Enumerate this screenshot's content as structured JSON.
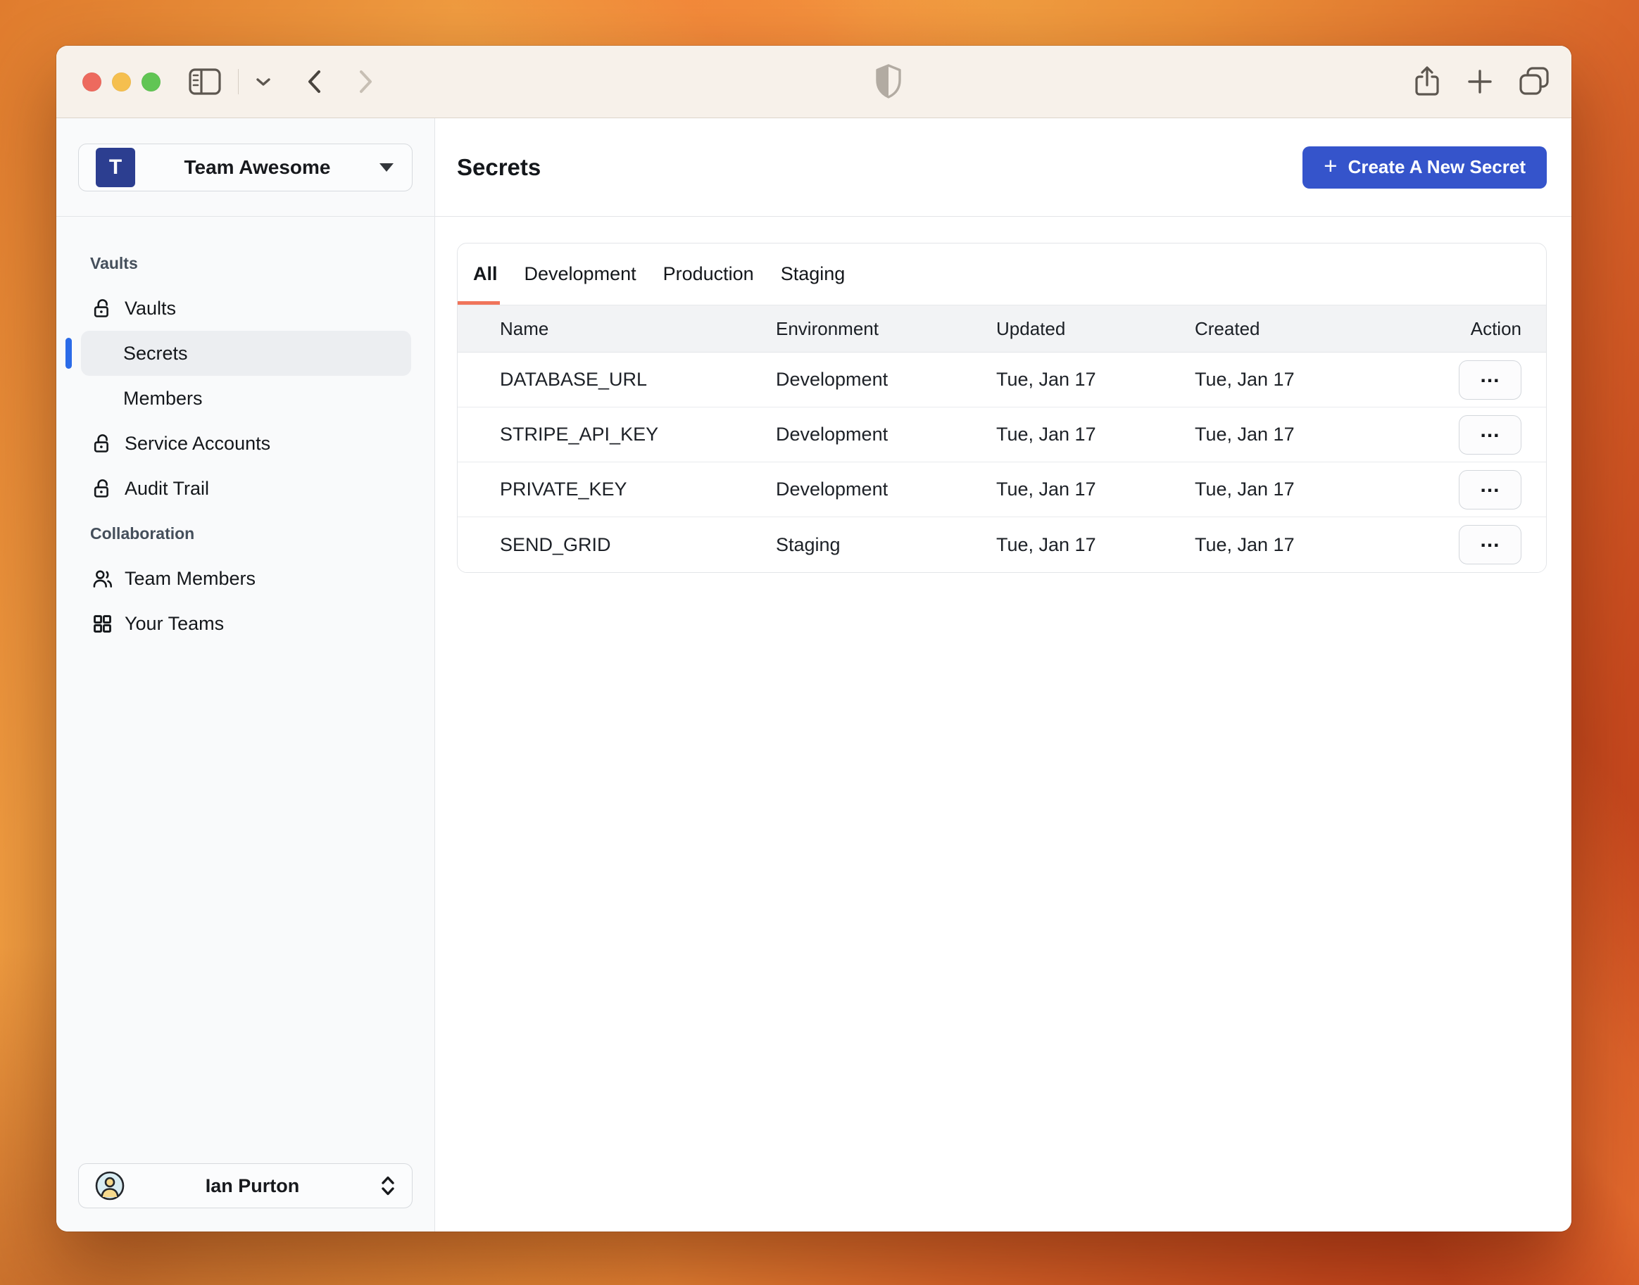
{
  "colors": {
    "accent_blue": "#3554cb",
    "selected_indicator_blue": "#2b6be8",
    "team_avatar_indigo": "#2c3e90",
    "active_tab_underline": "#f0745a",
    "traffic_red": "#ed6a5e",
    "traffic_yellow": "#f5bf4f",
    "traffic_green": "#61c554",
    "titlebar_bg": "#f7f1ea",
    "sidebar_bg": "#f9fafb"
  },
  "titlebar": {
    "icons": [
      "sidebar-toggle-icon",
      "chevron-down-icon",
      "back-icon",
      "forward-icon",
      "shield-icon",
      "share-icon",
      "new-tab-icon",
      "tab-overview-icon"
    ]
  },
  "sidebar": {
    "team_selector": {
      "initial": "T",
      "label": "Team Awesome"
    },
    "sections": [
      {
        "label": "Vaults",
        "items": [
          {
            "label": "Vaults",
            "icon": "lock-open-icon"
          },
          {
            "label": "Secrets",
            "selected": true
          },
          {
            "label": "Members"
          },
          {
            "label": "Service Accounts",
            "icon": "lock-open-icon"
          },
          {
            "label": "Audit Trail",
            "icon": "lock-open-icon"
          }
        ]
      },
      {
        "label": "Collaboration",
        "items": [
          {
            "label": "Team Members",
            "icon": "team-members-icon"
          },
          {
            "label": "Your Teams",
            "icon": "teams-grid-icon"
          }
        ]
      }
    ],
    "user": {
      "name": "Ian Purton"
    }
  },
  "main": {
    "title": "Secrets",
    "create_button_label": "Create A New Secret",
    "create_button_plus": "+",
    "tabs": [
      {
        "label": "All",
        "active": true
      },
      {
        "label": "Development"
      },
      {
        "label": "Production"
      },
      {
        "label": "Staging"
      }
    ],
    "table": {
      "columns": [
        "Name",
        "Environment",
        "Updated",
        "Created",
        "Action"
      ],
      "action_glyph": "...",
      "rows": [
        {
          "name": "DATABASE_URL",
          "environment": "Development",
          "updated": "Tue, Jan 17",
          "created": "Tue, Jan 17"
        },
        {
          "name": "STRIPE_API_KEY",
          "environment": "Development",
          "updated": "Tue, Jan 17",
          "created": "Tue, Jan 17"
        },
        {
          "name": "PRIVATE_KEY",
          "environment": "Development",
          "updated": "Tue, Jan 17",
          "created": "Tue, Jan 17"
        },
        {
          "name": "SEND_GRID",
          "environment": "Staging",
          "updated": "Tue, Jan 17",
          "created": "Tue, Jan 17"
        }
      ]
    }
  }
}
